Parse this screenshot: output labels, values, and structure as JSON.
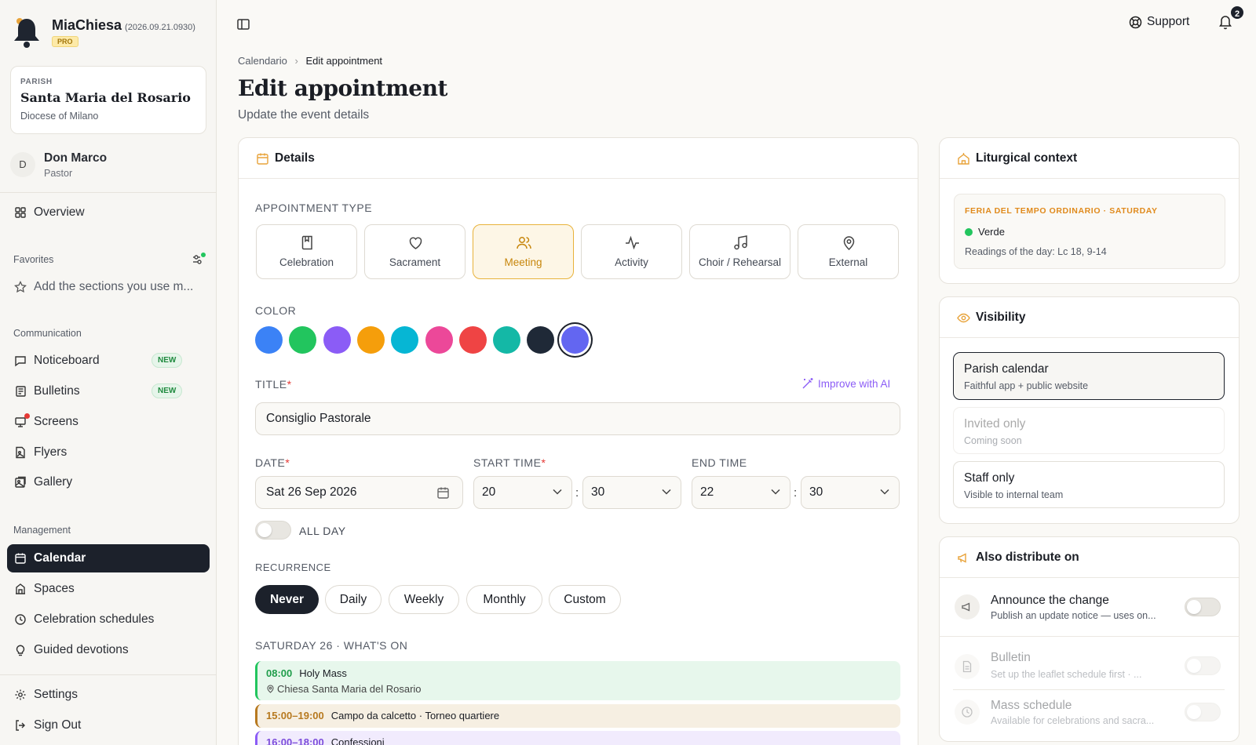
{
  "app": {
    "name": "MiaChiesa",
    "version": "(2026.09.21.0930)",
    "plan": "PRO"
  },
  "parish": {
    "kicker": "PARISH",
    "name": "Santa Maria del Rosario",
    "diocese": "Diocese of Milano"
  },
  "user": {
    "initial": "D",
    "name": "Don Marco",
    "role": "Pastor"
  },
  "sidebar": {
    "overview": "Overview",
    "favorites_title": "Favorites",
    "favorites_hint": "Add the sections you use m...",
    "communication_title": "Communication",
    "communication": [
      {
        "label": "Noticeboard",
        "badge": "NEW"
      },
      {
        "label": "Bulletins",
        "badge": "NEW"
      },
      {
        "label": "Screens"
      },
      {
        "label": "Flyers"
      },
      {
        "label": "Gallery"
      }
    ],
    "management_title": "Management",
    "management": [
      {
        "label": "Calendar"
      },
      {
        "label": "Spaces"
      },
      {
        "label": "Celebration schedules"
      },
      {
        "label": "Guided devotions"
      }
    ],
    "settings": "Settings",
    "signout": "Sign Out"
  },
  "topbar": {
    "support": "Support",
    "notifications": "2"
  },
  "breadcrumb": {
    "parent": "Calendario",
    "sep": "›",
    "current": "Edit appointment"
  },
  "page": {
    "title": "Edit appointment",
    "subtitle": "Update the event details"
  },
  "details": {
    "heading": "Details",
    "type_label": "APPOINTMENT TYPE",
    "types": [
      "Celebration",
      "Sacrament",
      "Meeting",
      "Activity",
      "Choir / Rehearsal",
      "External"
    ],
    "selected_type": "Meeting",
    "color_label": "COLOR",
    "colors": [
      "#3b82f6",
      "#22c55e",
      "#8b5cf6",
      "#f59e0b",
      "#06b6d4",
      "#ec4899",
      "#ef4444",
      "#14b8a6",
      "#1f2937",
      "#6366f1"
    ],
    "selected_color": "#6366f1",
    "title_label": "TITLE",
    "required_mark": "*",
    "improve_ai": "Improve with AI",
    "title_value": "Consiglio Pastorale",
    "date_label": "DATE",
    "date_value": "Sat 26 Sep 2026",
    "start_label": "START TIME",
    "start_h": "20",
    "start_m": "30",
    "end_label": "END TIME",
    "end_h": "22",
    "end_m": "30",
    "time_sep": ":",
    "allday": "ALL DAY",
    "recurrence_label": "RECURRENCE",
    "recurrence": [
      "Never",
      "Daily",
      "Weekly",
      "Monthly",
      "Custom"
    ],
    "recurrence_selected": "Never",
    "whatson_label": "SATURDAY 26 · WHAT'S ON",
    "events": [
      {
        "time": "08:00",
        "title": "Holy Mass",
        "place": "Chiesa Santa Maria del Rosario",
        "color": "#22c55e"
      },
      {
        "time": "15:00–19:00",
        "title": "Campo da calcetto · Torneo quartiere",
        "color": "#b7791f"
      },
      {
        "time": "16:00–18:00",
        "title": "Confessioni",
        "color": "#8b5cf6"
      }
    ]
  },
  "liturgical": {
    "heading": "Liturgical context",
    "day": "FERIA DEL TEMPO ORDINARIO · SATURDAY",
    "color_name": "Verde",
    "readings": "Readings of the day: Lc 18, 9-14"
  },
  "visibility": {
    "heading": "Visibility",
    "options": [
      {
        "title": "Parish calendar",
        "desc": "Faithful app + public website",
        "selected": true
      },
      {
        "title": "Invited only",
        "desc": "Coming soon",
        "disabled": true
      },
      {
        "title": "Staff only",
        "desc": "Visible to internal team"
      }
    ]
  },
  "distribute": {
    "heading": "Also distribute on",
    "items": [
      {
        "title": "Announce the change",
        "desc": "Publish an update notice — uses on..."
      },
      {
        "title": "Bulletin",
        "desc": "Set up the leaflet schedule first · ...",
        "disabled": true
      },
      {
        "title": "Mass schedule",
        "desc": "Available for celebrations and sacra...",
        "disabled": true
      }
    ]
  }
}
